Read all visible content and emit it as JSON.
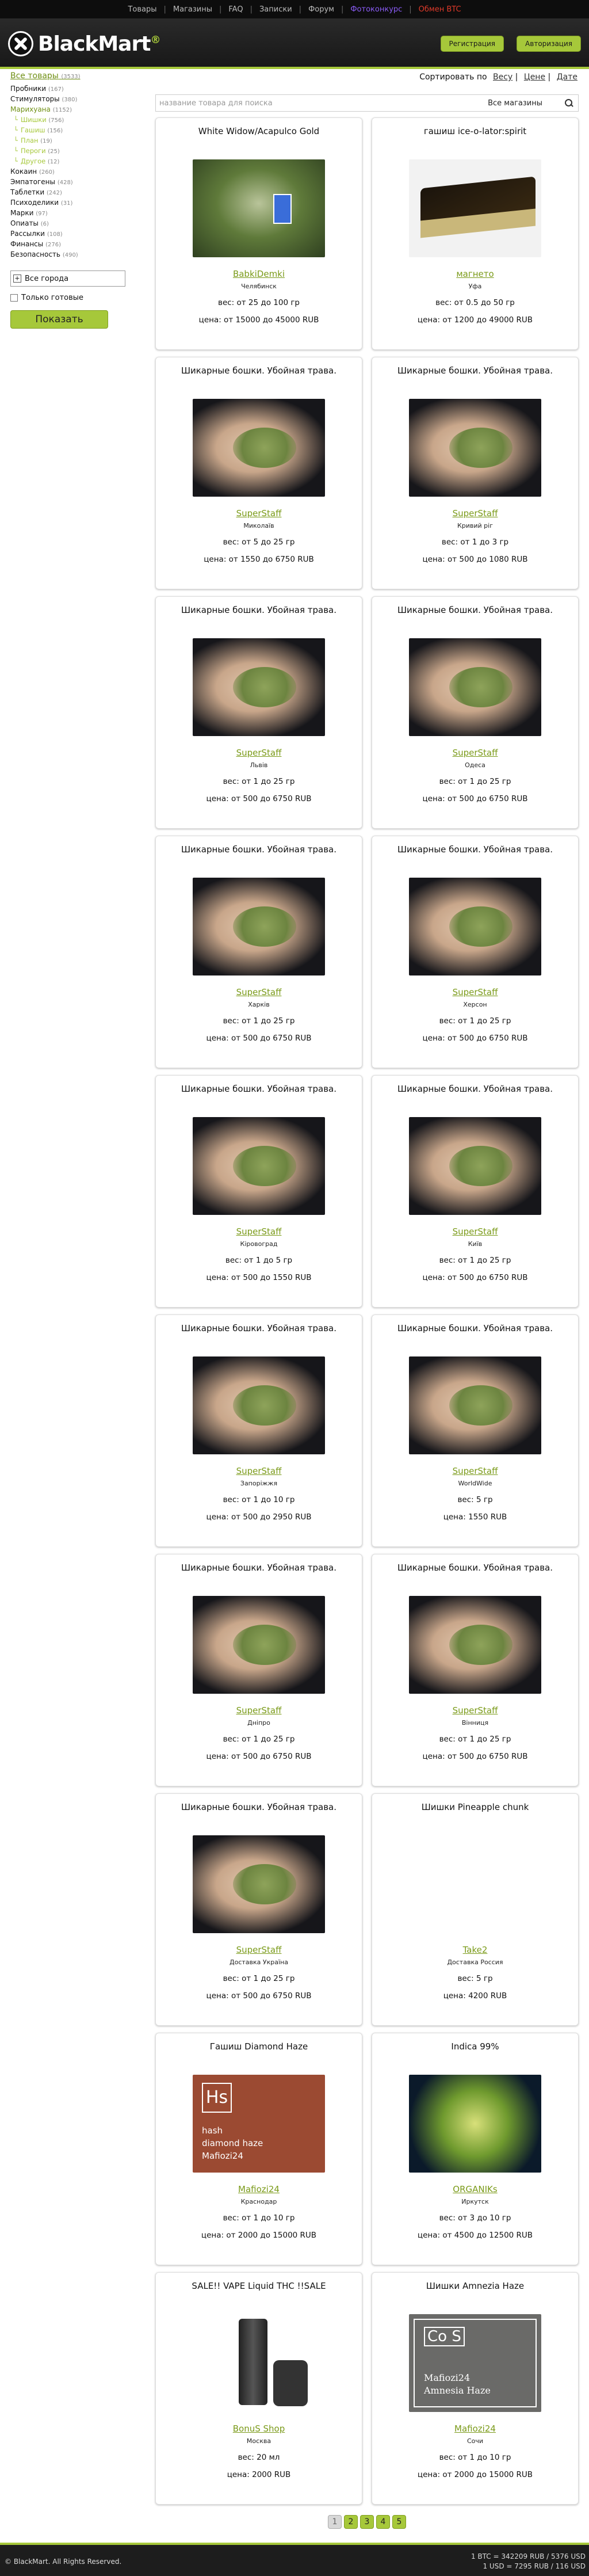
{
  "topnav": {
    "items": [
      "Товары",
      "Магазины",
      "FAQ",
      "Записки",
      "Форум",
      "Фотоконкурс",
      "Обмен BTC"
    ],
    "accent_purple": "#8a5cf5",
    "accent_red": "#e03a2a"
  },
  "header": {
    "logo_text": "BlackMart",
    "register_label": "Регистрация",
    "login_label": "Авторизация",
    "brand_color": "#a6c83a"
  },
  "sidebar": {
    "all_label": "Все товары",
    "all_count": "(3533)",
    "categories": [
      {
        "label": "Пробники",
        "count": "(167)",
        "style": "normal"
      },
      {
        "label": "Стимуляторы",
        "count": "(380)",
        "style": "normal"
      },
      {
        "label": "Марихуана",
        "count": "(1152)",
        "style": "green"
      },
      {
        "label": "Шишки",
        "count": "(756)",
        "style": "sub"
      },
      {
        "label": "Гашиш",
        "count": "(156)",
        "style": "sub"
      },
      {
        "label": "План",
        "count": "(19)",
        "style": "sub"
      },
      {
        "label": "Пероги",
        "count": "(25)",
        "style": "sub"
      },
      {
        "label": "Другое",
        "count": "(12)",
        "style": "sub"
      },
      {
        "label": "Кокаин",
        "count": "(260)",
        "style": "normal"
      },
      {
        "label": "Эмпатогены",
        "count": "(428)",
        "style": "normal"
      },
      {
        "label": "Таблетки",
        "count": "(242)",
        "style": "normal"
      },
      {
        "label": "Психоделики",
        "count": "(31)",
        "style": "normal"
      },
      {
        "label": "Марки",
        "count": "(97)",
        "style": "normal"
      },
      {
        "label": "Опиаты",
        "count": "(6)",
        "style": "normal"
      },
      {
        "label": "Рассылки",
        "count": "(108)",
        "style": "normal"
      },
      {
        "label": "Финансы",
        "count": "(276)",
        "style": "normal"
      },
      {
        "label": "Безопасность",
        "count": "(490)",
        "style": "normal"
      }
    ],
    "city_label": "Все города",
    "ready_only_label": "Только готовые",
    "show_button": "Показать"
  },
  "sort": {
    "label": "Сортировать по",
    "options": [
      "Весу",
      "Цене",
      "Дате"
    ]
  },
  "search": {
    "placeholder": "название товара для поиска",
    "shops_label": "Все магазины"
  },
  "products": [
    {
      "title": "White Widow/Acapulco Gold",
      "image": "weed",
      "seller": "BabkiDemki",
      "city": "Челябинск",
      "weight": "вес: от 25 до 100 гр",
      "price": "цена: от 15000 до 45000 RUB"
    },
    {
      "title": "гашиш ice-o-lator:spirit",
      "image": "hash",
      "seller": "магнето",
      "city": "Уфа",
      "weight": "вес: от 0.5 до 50 гр",
      "price": "цена: от 1200 до 49000 RUB"
    },
    {
      "title": "Шикарные бошки. Убойная трава.",
      "image": "hand",
      "seller": "SuperStaff",
      "city": "Миколаїв",
      "weight": "вес: от 5 до 25 гр",
      "price": "цена: от 1550 до 6750 RUB"
    },
    {
      "title": "Шикарные бошки. Убойная трава.",
      "image": "hand",
      "seller": "SuperStaff",
      "city": "Кривий ріг",
      "weight": "вес: от 1 до 3 гр",
      "price": "цена: от 500 до 1080 RUB"
    },
    {
      "title": "Шикарные бошки. Убойная трава.",
      "image": "hand",
      "seller": "SuperStaff",
      "city": "Львів",
      "weight": "вес: от 1 до 25 гр",
      "price": "цена: от 500 до 6750 RUB"
    },
    {
      "title": "Шикарные бошки. Убойная трава.",
      "image": "hand",
      "seller": "SuperStaff",
      "city": "Одеса",
      "weight": "вес: от 1 до 25 гр",
      "price": "цена: от 500 до 6750 RUB"
    },
    {
      "title": "Шикарные бошки. Убойная трава.",
      "image": "hand",
      "seller": "SuperStaff",
      "city": "Харків",
      "weight": "вес: от 1 до 25 гр",
      "price": "цена: от 500 до 6750 RUB"
    },
    {
      "title": "Шикарные бошки. Убойная трава.",
      "image": "hand",
      "seller": "SuperStaff",
      "city": "Херсон",
      "weight": "вес: от 1 до 25 гр",
      "price": "цена: от 500 до 6750 RUB"
    },
    {
      "title": "Шикарные бошки. Убойная трава.",
      "image": "hand",
      "seller": "SuperStaff",
      "city": "Кіровоград",
      "weight": "вес: от 1 до 5 гр",
      "price": "цена: от 500 до 1550 RUB"
    },
    {
      "title": "Шикарные бошки. Убойная трава.",
      "image": "hand",
      "seller": "SuperStaff",
      "city": "Київ",
      "weight": "вес: от 1 до 25 гр",
      "price": "цена: от 500 до 6750 RUB"
    },
    {
      "title": "Шикарные бошки. Убойная трава.",
      "image": "hand",
      "seller": "SuperStaff",
      "city": "Запоріжжя",
      "weight": "вес: от 1 до 10 гр",
      "price": "цена: от 500 до 2950 RUB"
    },
    {
      "title": "Шикарные бошки. Убойная трава.",
      "image": "hand",
      "seller": "SuperStaff",
      "city": "WorldWide",
      "weight": "вес: 5 гр",
      "price": "цена: 1550 RUB"
    },
    {
      "title": "Шикарные бошки. Убойная трава.",
      "image": "hand",
      "seller": "SuperStaff",
      "city": "Дніпро",
      "weight": "вес: от 1 до 25 гр",
      "price": "цена: от 500 до 6750 RUB"
    },
    {
      "title": "Шикарные бошки. Убойная трава.",
      "image": "hand",
      "seller": "SuperStaff",
      "city": "Вінниця",
      "weight": "вес: от 1 до 25 гр",
      "price": "цена: от 500 до 6750 RUB"
    },
    {
      "title": "Шикарные бошки. Убойная трава.",
      "image": "hand",
      "seller": "SuperStaff",
      "city": "Доставка Україна",
      "weight": "вес: от 1 до 25 гр",
      "price": "цена: от 500 до 6750 RUB"
    },
    {
      "title": "Шишки Pineapple chunk",
      "image": "none",
      "seller": "Take2",
      "city": "Доставка Россия",
      "weight": "вес: 5 гр",
      "price": "цена: 4200 RUB"
    },
    {
      "title": "Гашиш Diamond Haze",
      "image": "brandhash",
      "seller": "Mafiozi24",
      "city": "Краснодар",
      "weight": "вес: от 1 до 10 гр",
      "price": "цена: от 2000 до 15000 RUB",
      "image_text": [
        "hash",
        "diamond haze",
        "Mafiozi24"
      ],
      "image_badge": "Hs"
    },
    {
      "title": "Indica 99%",
      "image": "indica",
      "seller": "ORGANIKs",
      "city": "Иркутск",
      "weight": "вес: от 3 до 10 гр",
      "price": "цена: от 4500 до 12500 RUB"
    },
    {
      "title": "SALE!! VAPE Liquid THC !!SALE",
      "image": "vape",
      "seller": "BonuS Shop",
      "city": "Москва",
      "weight": "вес: 20 мл",
      "price": "цена: 2000 RUB"
    },
    {
      "title": "Шишки Amnezia Haze",
      "image": "amnesia",
      "seller": "Mafiozi24",
      "city": "Сочи",
      "weight": "вес: от 1 до 10 гр",
      "price": "цена: от 2000 до 15000 RUB",
      "image_text": [
        "Mafiozi24",
        "Amnesia Haze"
      ],
      "image_badge": "Co S"
    }
  ],
  "pagination": {
    "pages": [
      "1",
      "2",
      "3",
      "4",
      "5"
    ],
    "current": "1"
  },
  "footer": {
    "copyright": "© BlackMart. All Rights Reserved.",
    "rate_btc": "1 BTC = 342209 RUB / 5376 USD",
    "rate_usd": "1 USD = 7295 RUB / 116 USD"
  }
}
